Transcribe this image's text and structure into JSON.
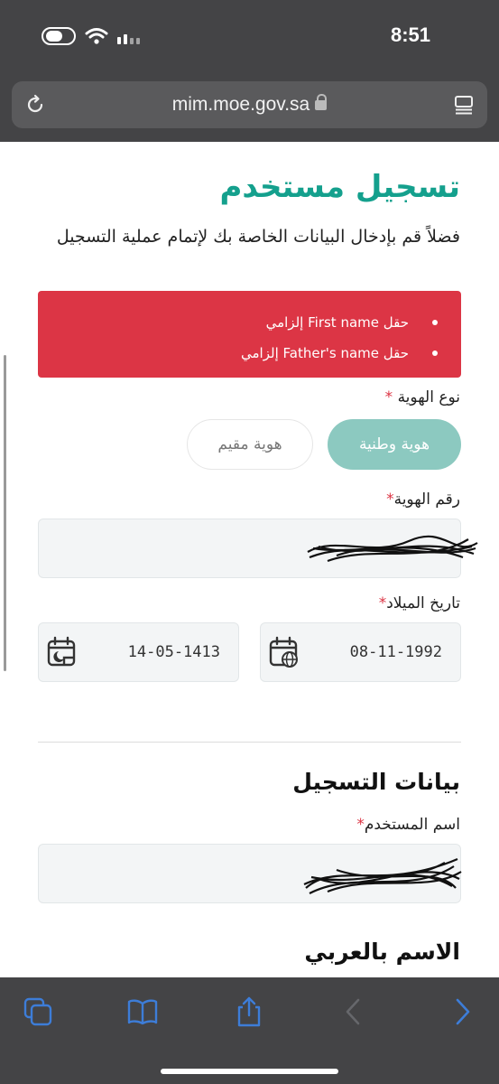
{
  "status_bar": {
    "time": "8:51"
  },
  "browser": {
    "url": "mim.moe.gov.sa"
  },
  "page": {
    "title": "تسجيل مستخدم",
    "subtitle": "فضلاً قم بإدخال البيانات الخاصة بك لإتمام عملية التسجيل",
    "errors": [
      "حقل First name إلزامي",
      "حقل Father's name إلزامي"
    ],
    "id_type": {
      "label": "نوع الهوية",
      "required_mark": "*",
      "options": [
        "هوية وطنية",
        "هوية مقيم"
      ],
      "selected": "هوية وطنية"
    },
    "id_number": {
      "label": "رقم الهوية",
      "required_mark": "*"
    },
    "birth_date": {
      "label": "تاريخ الميلاد",
      "required_mark": "*",
      "gregorian": "08-11-1992",
      "hijri": "14-05-1413"
    },
    "registration_section": {
      "title": "بيانات التسجيل"
    },
    "username": {
      "label": "اسم المستخدم",
      "required_mark": "*"
    },
    "arabic_name_section": {
      "title": "الاسم بالعربي"
    }
  },
  "colors": {
    "accent": "#14a08d",
    "alert": "#dc3545",
    "selected_pill": "#8cc9c0",
    "toolbar_tint": "#3d7dd8"
  },
  "icons": [
    "toggle-icon",
    "wifi-icon",
    "signal-icon",
    "reload-icon",
    "lock-icon",
    "reader-icon",
    "calendar-globe-icon",
    "calendar-moon-icon",
    "tabs-icon",
    "bookmarks-icon",
    "share-icon",
    "back-icon",
    "forward-icon"
  ]
}
